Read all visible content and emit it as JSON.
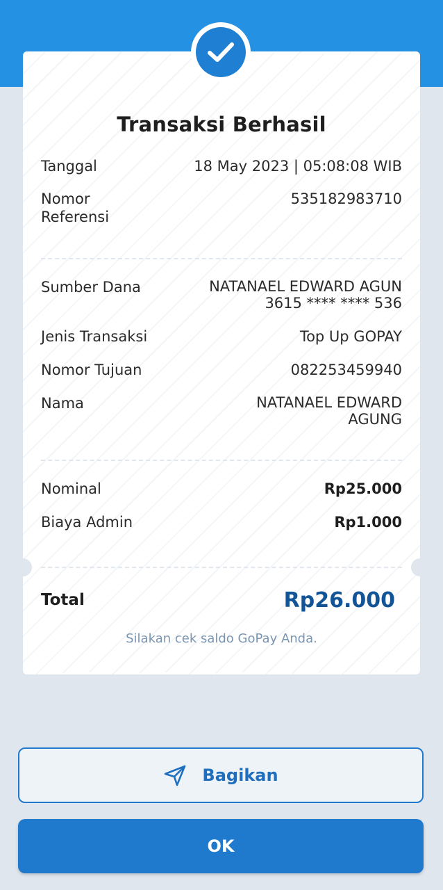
{
  "colors": {
    "header_blue": "#2591e2",
    "accent_blue": "#1f79cd",
    "total_blue": "#125496",
    "note_text": "#7a95b0",
    "page_bg": "#dfe6ee"
  },
  "icons": {
    "status": "check-icon",
    "share": "send-icon"
  },
  "receipt": {
    "title": "Transaksi Berhasil",
    "tanggal": {
      "label": "Tanggal",
      "value": "18 May 2023 | 05:08:08 WIB"
    },
    "referensi": {
      "label_line1": "Nomor",
      "label_line2": "Referensi",
      "value": "535182983710"
    },
    "sumber_dana": {
      "label": "Sumber Dana",
      "name": "NATANAEL EDWARD AGUN",
      "account": "3615 **** **** 536"
    },
    "jenis": {
      "label": "Jenis Transaksi",
      "value": "Top Up GOPAY"
    },
    "tujuan": {
      "label": "Nomor Tujuan",
      "value": "082253459940"
    },
    "nama": {
      "label": "Nama",
      "value_line1": "NATANAEL EDWARD",
      "value_line2": "AGUNG"
    },
    "nominal": {
      "label": "Nominal",
      "value": "Rp25.000"
    },
    "admin": {
      "label": "Biaya Admin",
      "value": "Rp1.000"
    },
    "total": {
      "label": "Total",
      "value": "Rp26.000"
    },
    "note": "Silakan cek saldo GoPay Anda."
  },
  "actions": {
    "share_label": "Bagikan",
    "ok_label": "OK"
  }
}
